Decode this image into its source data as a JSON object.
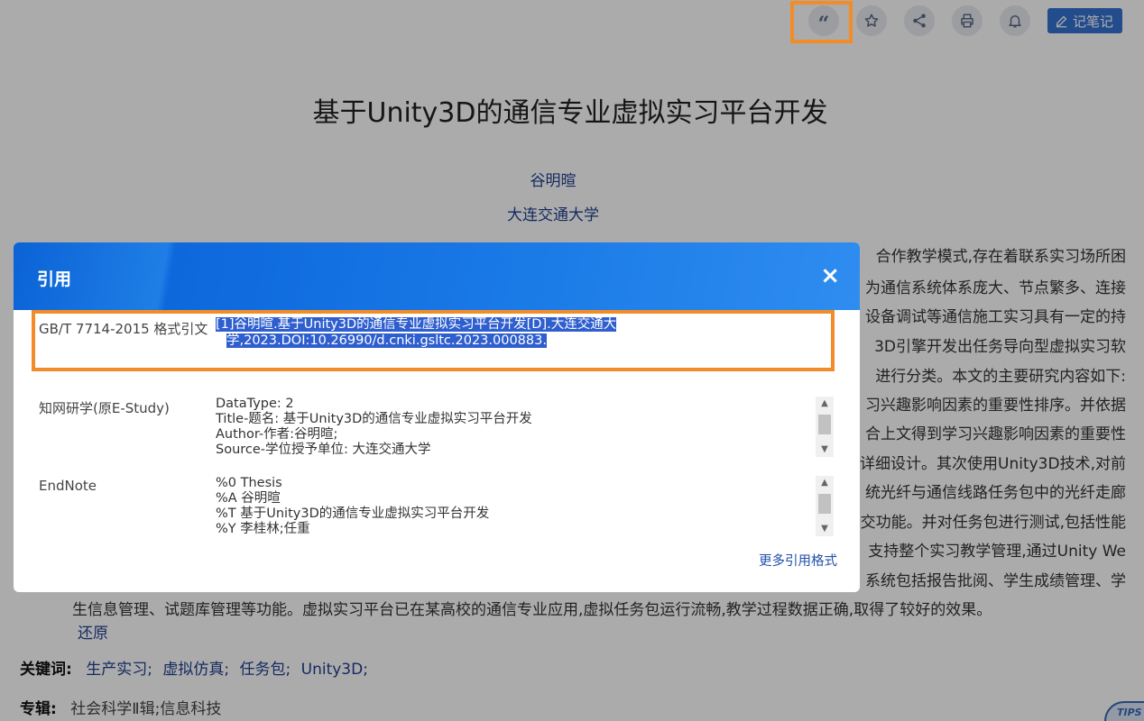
{
  "toolbar": {
    "cite_glyph": "“",
    "note_label": "记笔记"
  },
  "article": {
    "title": "基于Unity3D的通信专业虚拟实习平台开发",
    "author": "谷明暄",
    "affiliation": "大连交通大学",
    "abstract_right_lines": [
      "合作教学模式,存在着联系实习场所困",
      "为通信系统体系庞大、节点繁多、连接",
      "设备调试等通信施工实习具有一定的持",
      "3D引擎开发出任务导向型虚拟实习软",
      "进行分类。本文的主要研究内容如下:",
      "习兴趣影响因素的重要性排序。并依据",
      "合上文得到学习兴趣影响因素的重要性",
      "详细设计。其次使用Unity3D技术,对前",
      "统光纤与通信线路任务包中的光纤走廊",
      "交功能。并对任务包进行测试,包括性能",
      "支持整个实习教学管理,通过Unity We",
      "系统包括报告批阅、学生成绩管理、学"
    ],
    "abstract_last_line": "生信息管理、试题库管理等功能。虚拟实习平台已在某高校的通信专业应用,虚拟任务包运行流畅,教学过程数据正确,取得了较好的效果。",
    "restore_label": "还原",
    "keywords_label": "关键词:",
    "keywords": [
      "生产实习;",
      "虚拟仿真;",
      "任务包;",
      "Unity3D;"
    ],
    "series_label": "专辑:",
    "series_value": "社会科学Ⅱ辑;信息科技",
    "tips_label": "TIPS"
  },
  "modal": {
    "title": "引用",
    "close_glyph": "×",
    "gbt": {
      "label": "GB/T 7714-2015 格式引文",
      "line1": "[1]谷明暄.基于Unity3D的通信专业虚拟实习平台开发[D].大连交通大",
      "line2": "学,2023.DOI:10.26990/d.cnki.gsltc.2023.000883."
    },
    "estudy": {
      "label": "知网研学(原E-Study)",
      "lines": [
        "DataType: 2",
        "Title-题名: 基于Unity3D的通信专业虚拟实习平台开发",
        "Author-作者:谷明暄;",
        "Source-学位授予单位: 大连交通大学"
      ]
    },
    "endnote": {
      "label": "EndNote",
      "lines": [
        "%0 Thesis",
        "%A 谷明暄",
        "%T 基于Unity3D的通信专业虚拟实习平台开发",
        "%Y 李桂林;任重"
      ]
    },
    "more_label": "更多引用格式"
  }
}
